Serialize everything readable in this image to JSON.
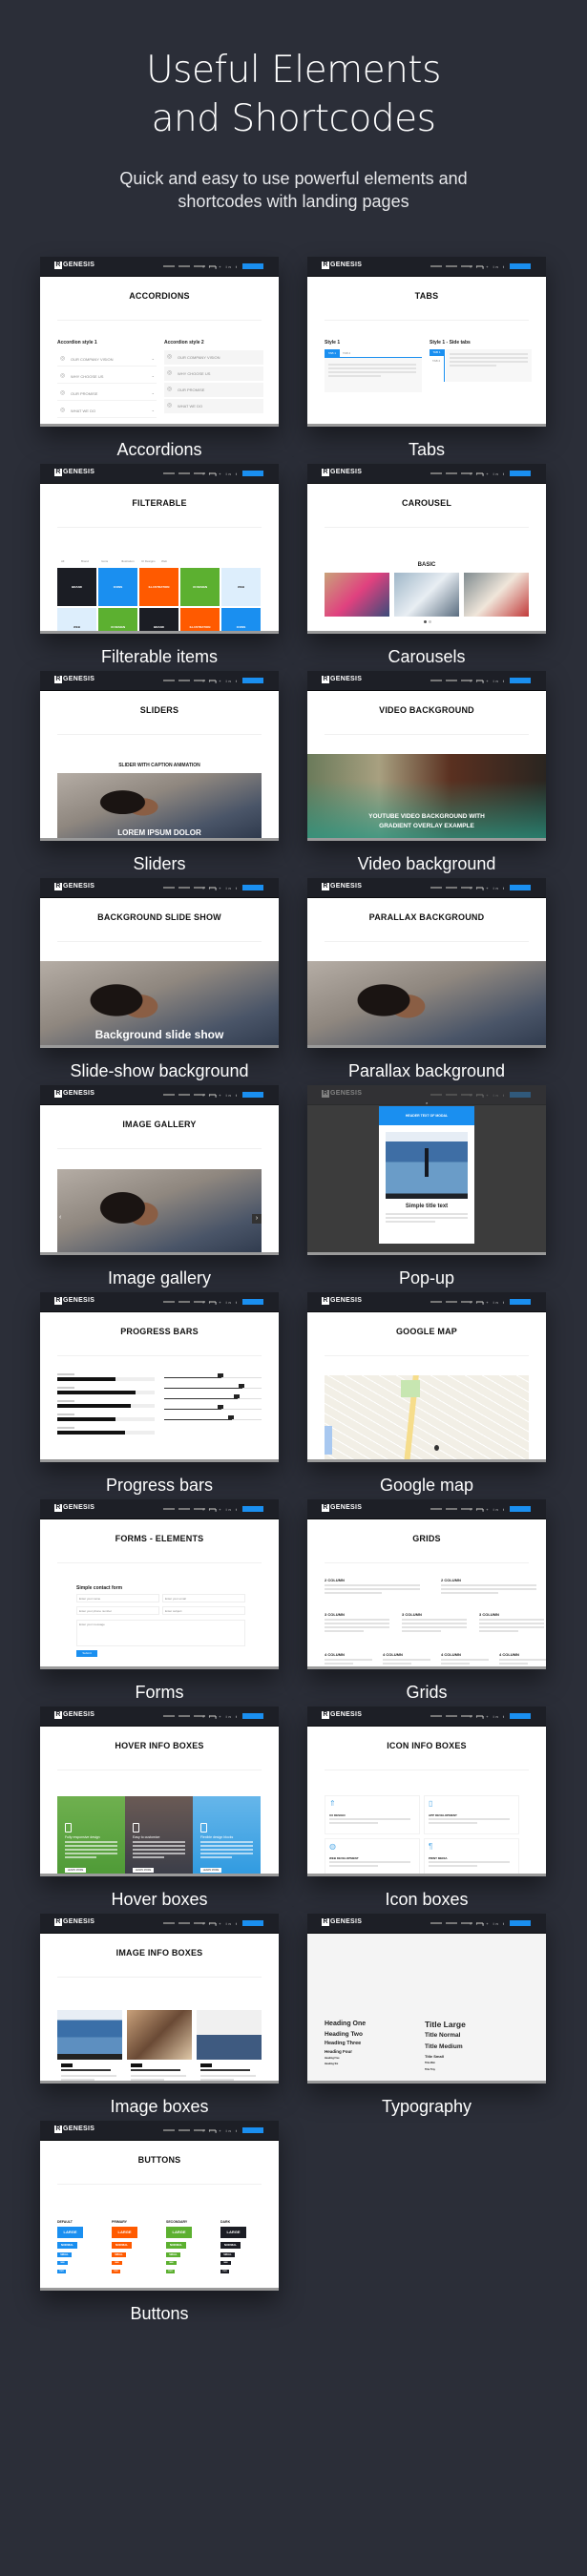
{
  "hero": {
    "title_line1": "Useful Elements",
    "title_line2": "and Shortcodes",
    "subtitle_line1": "Quick and easy to use powerful elements and",
    "subtitle_line2": "shortcodes with landing pages"
  },
  "nav": {
    "logo_mark": "R",
    "logo_text": "GENESIS",
    "social_icons": "f t g+ in t"
  },
  "colors": {
    "background": "#2b2e38",
    "accent": "#1a8ff0",
    "primary": "#ff5a00",
    "secondary": "#5cb030",
    "dark": "#1b1d24"
  },
  "items": [
    {
      "label": "Accordions",
      "kind": "accordions",
      "page_title": "ACCORDIONS",
      "style1": "Accordion style 1",
      "style2": "Accordion style 2",
      "rows": [
        "OUR COMPANY VISION",
        "WHY CHOOSE US",
        "OUR PROMISE",
        "WHAT WE DO"
      ]
    },
    {
      "label": "Tabs",
      "kind": "tabs",
      "page_title": "TABS",
      "style1": "Style 1",
      "style2": "Style 1 - Side tabs",
      "tabs": [
        "TAB 1",
        "TAB 2"
      ]
    },
    {
      "label": "Filterable items",
      "kind": "filterable",
      "page_title": "FILTERABLE",
      "filters": [
        "All",
        "Brand",
        "Icons",
        "Illustration",
        "UI Designs",
        "Web"
      ],
      "tiles": [
        {
          "t": "BRAND",
          "c": "#1b1d24"
        },
        {
          "t": "ICONS",
          "c": "#1a8ff0"
        },
        {
          "t": "ILLUSTRATION",
          "c": "#ff5a00"
        },
        {
          "t": "UI DESIGN",
          "c": "#5cb030"
        },
        {
          "t": "WEB",
          "c": "#ddeefc"
        },
        {
          "t": "WEB",
          "c": "#ddeefc"
        },
        {
          "t": "UI DESIGN",
          "c": "#5cb030"
        },
        {
          "t": "BRAND",
          "c": "#1b1d24"
        },
        {
          "t": "ILLUSTRATION",
          "c": "#ff5a00"
        },
        {
          "t": "ICONS",
          "c": "#1a8ff0"
        }
      ]
    },
    {
      "label": "Carousels",
      "kind": "carousel",
      "page_title": "CAROUSEL",
      "sub": "BASIC"
    },
    {
      "label": "Sliders",
      "kind": "sliders",
      "page_title": "SLIDERS",
      "sub": "SLIDER WITH CAPTION ANIMATION",
      "caption": "LOREM IPSUM DOLOR"
    },
    {
      "label": "Video background",
      "kind": "video",
      "page_title": "VIDEO BACKGROUND",
      "caption": "YOUTUBE VIDEO BACKGROUND WITH GRADIENT OVERLAY EXAMPLE"
    },
    {
      "label": "Slide-show background",
      "kind": "slideshow",
      "page_title": "BACKGROUND SLIDE SHOW",
      "caption": "Background slide show"
    },
    {
      "label": "Parallax background",
      "kind": "parallax",
      "page_title": "PARALLAX BACKGROUND"
    },
    {
      "label": "Image gallery",
      "kind": "gallery",
      "page_title": "IMAGE GALLERY"
    },
    {
      "label": "Pop-up",
      "kind": "popup",
      "modal_header": "HEADER TEXT OF MODAL",
      "modal_title": "Simple title text"
    },
    {
      "label": "Progress bars",
      "kind": "progress",
      "page_title": "PROGRESS BARS",
      "bars_percent": [
        60,
        80,
        75,
        60,
        70
      ],
      "sliders_percent": [
        59,
        80,
        75,
        59,
        70
      ]
    },
    {
      "label": "Google map",
      "kind": "map",
      "page_title": "GOOGLE MAP"
    },
    {
      "label": "Forms",
      "kind": "forms",
      "page_title": "FORMS - ELEMENTS",
      "form_title": "Simple contact form",
      "fields": [
        "Enter your name",
        "Enter your email",
        "Enter your phone number",
        "Enter subject"
      ],
      "message": "Enter your message",
      "submit": "Submit"
    },
    {
      "label": "Grids",
      "kind": "grids",
      "page_title": "GRIDS",
      "cols": [
        "2 COLUMN",
        "3 COLUMN",
        "4 COLUMN"
      ]
    },
    {
      "label": "Hover boxes",
      "kind": "hover",
      "page_title": "HOVER INFO BOXES",
      "boxes": [
        "Fully responsive design",
        "Easy to customize",
        "Flexible design blocks"
      ],
      "button": "LEARN MORE"
    },
    {
      "label": "Icon boxes",
      "kind": "icon",
      "page_title": "ICON INFO BOXES",
      "boxes": [
        "UX DESIGN",
        "APP DEVELOPMENT",
        "WEB DEVELOPMENT",
        "PRINT MEDIA"
      ]
    },
    {
      "label": "Image boxes",
      "kind": "imagebox",
      "page_title": "IMAGE INFO BOXES"
    },
    {
      "label": "Typography",
      "kind": "typography",
      "page_title": "TYPOGRAPHY",
      "headings": [
        "Heading One",
        "Heading Two",
        "Heading Three",
        "Heading Four",
        "Heading Five",
        "Heading Six"
      ],
      "titles": [
        "Title Large",
        "Title Normal",
        "Title Medium",
        "Title Small",
        "Title Mini",
        "Title Tiny"
      ]
    },
    {
      "label": "Buttons",
      "kind": "buttons",
      "page_title": "BUTTONS",
      "columns": [
        "DEFAULT",
        "PRIMARY",
        "SECONDARY",
        "DARK"
      ],
      "sizes": [
        "LARGE",
        "NORMAL",
        "SMALL",
        "MINI",
        "TINY"
      ]
    }
  ]
}
